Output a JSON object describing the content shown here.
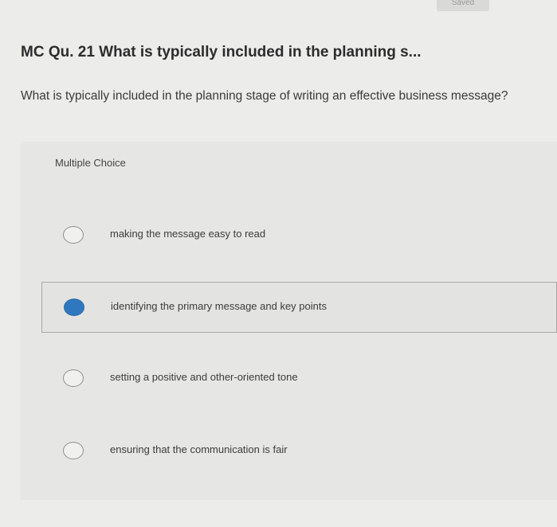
{
  "header": {
    "saved_label": "Saved"
  },
  "question": {
    "title": "MC Qu. 21 What is typically included in the planning s...",
    "prompt": "What is typically included in the planning stage of writing an effective business message?"
  },
  "answer": {
    "type_label": "Multiple Choice",
    "selected_index": 1,
    "options": [
      {
        "label": "making the message easy to read",
        "selected": false
      },
      {
        "label": "identifying the primary message and key points",
        "selected": true
      },
      {
        "label": "setting a positive and other-oriented tone",
        "selected": false
      },
      {
        "label": "ensuring that the communication is fair",
        "selected": false
      }
    ]
  },
  "colors": {
    "selected_radio": "#2f78c0",
    "background": "#ececea"
  }
}
